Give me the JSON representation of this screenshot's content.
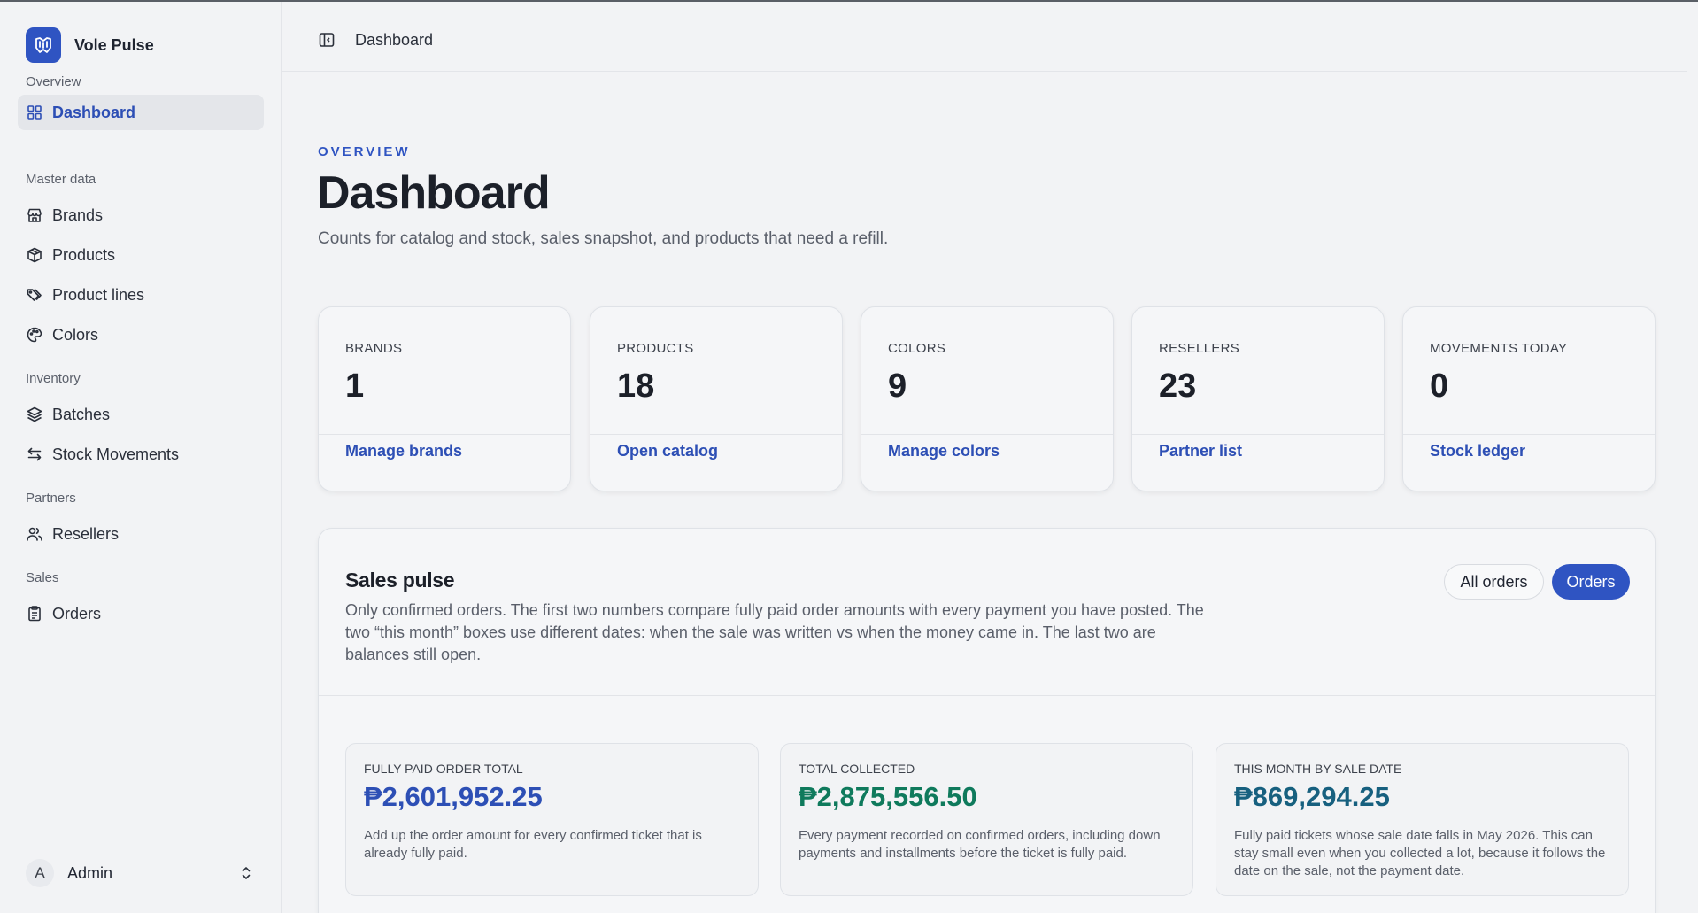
{
  "app": {
    "name": "Vole Pulse"
  },
  "sidebar": {
    "sections": [
      {
        "label": "Overview"
      },
      {
        "label": "Master data"
      },
      {
        "label": "Inventory"
      },
      {
        "label": "Partners"
      },
      {
        "label": "Sales"
      }
    ],
    "items": [
      {
        "label": "Dashboard",
        "icon": "grid-icon",
        "active": true
      },
      {
        "label": "Brands",
        "icon": "store-icon"
      },
      {
        "label": "Products",
        "icon": "box-icon"
      },
      {
        "label": "Product lines",
        "icon": "tags-icon"
      },
      {
        "label": "Colors",
        "icon": "palette-icon"
      },
      {
        "label": "Batches",
        "icon": "layers-icon"
      },
      {
        "label": "Stock Movements",
        "icon": "arrows-icon"
      },
      {
        "label": "Resellers",
        "icon": "users-icon"
      },
      {
        "label": "Orders",
        "icon": "clipboard-icon"
      }
    ],
    "user": {
      "initial": "A",
      "name": "Admin"
    }
  },
  "header": {
    "breadcrumb": "Dashboard"
  },
  "main": {
    "eyebrow": "OVERVIEW",
    "title": "Dashboard",
    "subtitle": "Counts for catalog and stock, sales snapshot, and products that need a refill.",
    "stats": [
      {
        "label": "BRANDS",
        "value": "1",
        "link": "Manage brands"
      },
      {
        "label": "PRODUCTS",
        "value": "18",
        "link": "Open catalog"
      },
      {
        "label": "COLORS",
        "value": "9",
        "link": "Manage colors"
      },
      {
        "label": "RESELLERS",
        "value": "23",
        "link": "Partner list"
      },
      {
        "label": "MOVEMENTS TODAY",
        "value": "0",
        "link": "Stock ledger"
      }
    ],
    "pulse": {
      "title": "Sales pulse",
      "description": "Only confirmed orders. The first two numbers compare fully paid order amounts with every payment you have posted. The two “this month” boxes use different dates: when the sale was written vs when the money came in. The last two are balances still open.",
      "buttons": {
        "all_orders": "All orders",
        "orders": "Orders"
      },
      "metrics": [
        {
          "label": "FULLY PAID ORDER TOTAL",
          "value": "₱2,601,952.25",
          "color": "#2d4fb5",
          "desc": "Add up the order amount for every confirmed ticket that is already fully paid."
        },
        {
          "label": "TOTAL COLLECTED",
          "value": "₱2,875,556.50",
          "color": "#0f7a5c",
          "desc": "Every payment recorded on confirmed orders, including down payments and installments before the ticket is fully paid."
        },
        {
          "label": "THIS MONTH BY SALE DATE",
          "value": "₱869,294.25",
          "color": "#17607f",
          "desc": "Fully paid tickets whose sale date falls in May 2026. This can stay small even when you collected a lot, because it follows the date on the sale, not the payment date."
        }
      ]
    }
  },
  "colors": {
    "accent": "#2f54c2",
    "background": "#f2f3f5"
  }
}
